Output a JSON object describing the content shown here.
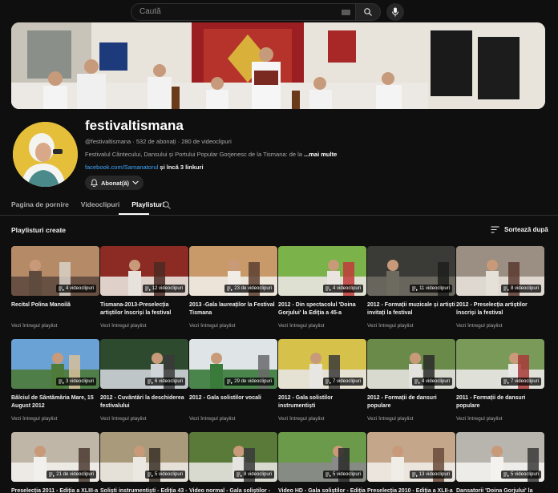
{
  "search": {
    "placeholder": "Caută"
  },
  "icons": {
    "keyboard": "keyboard-icon",
    "search": "search-icon",
    "mic": "mic-icon",
    "bell": "bell-icon",
    "chevron": "chevron-down-icon",
    "sort": "sort-icon",
    "playlist": "playlist-icon"
  },
  "channel": {
    "name": "festivaltismana",
    "handle": "@festivaltismana",
    "subscribers": "532 de abonați",
    "videos": "280 de videoclipuri",
    "separator": " · ",
    "description": "Festivalul Cântecului, Dansului și Portului Popular Gorjenesc de la Tismana: de la ediț",
    "more_label": "...mai multe",
    "link": "facebook.com/Samanatorul",
    "extra_links": " și încă 3 linkuri",
    "subscribe_label": "Abonat(ă)"
  },
  "tabs": [
    {
      "label": "Pagina de pornire"
    },
    {
      "label": "Videoclipuri"
    },
    {
      "label": "Playlisturi",
      "active": true
    }
  ],
  "section": {
    "title": "Playlisturi create",
    "sort_label": "Sortează după"
  },
  "view_full": "Vezi întregul playlist",
  "playlists": [
    {
      "title": "Recital Polina Manoilă",
      "count": "4 videoclipuri",
      "colors": [
        "#b58b67",
        "#5f4a3e",
        "#d7d1c8"
      ]
    },
    {
      "title": "Tismana-2013-Preselecția artiștilor înscriși la festival",
      "count": "12 videoclipuri",
      "colors": [
        "#8c2a24",
        "#e8e2dc",
        "#4a2a22"
      ]
    },
    {
      "title": "2013 -Gala laureaților la Festival Tismana",
      "count": "23 de videoclipuri",
      "colors": [
        "#c89a6a",
        "#f0ece6",
        "#5c4030"
      ]
    },
    {
      "title": "2012 - Din spectacolul 'Doina Gorjului' la Ediția a 45-a",
      "count": "4 videoclipuri",
      "colors": [
        "#7bb34a",
        "#e9e4e0",
        "#c23a3a"
      ]
    },
    {
      "title": "2012 - Formații muzicale și artiști invitați la festival",
      "count": "11 videoclipuri",
      "colors": [
        "#3a3a36",
        "#6d6a60",
        "#1e1e1c"
      ]
    },
    {
      "title": "2012 - Preselecția artiștilor înscriși la festival",
      "count": "8 videoclipuri",
      "colors": [
        "#9a8f82",
        "#e5e0d8",
        "#5a3a30"
      ]
    },
    {
      "title": "Bâlciul de Sântămăria Mare, 15 August 2012",
      "count": "3 videoclipuri",
      "colors": [
        "#6aa2d6",
        "#4e7a3a",
        "#d8c09a"
      ]
    },
    {
      "title": "2012 - Cuvântări la deschiderea festivalului",
      "count": "6 videoclipuri",
      "colors": [
        "#2e4a2e",
        "#cfd4d8",
        "#3a3a3a"
      ]
    },
    {
      "title": "2012 - Gala solistilor vocali",
      "count": "29 de videoclipuri",
      "colors": [
        "#dfe4e6",
        "#3a7a3a",
        "#6a6a6a"
      ]
    },
    {
      "title": "2012 - Gala solistilor instrumentiști",
      "count": "7 videoclipuri",
      "colors": [
        "#d6c24a",
        "#e8e6e2",
        "#3a3a3a"
      ]
    },
    {
      "title": "2012 - Formații de dansuri populare",
      "count": "4 videoclipuri",
      "colors": [
        "#6a8a4a",
        "#e4e2de",
        "#2a2a2a"
      ]
    },
    {
      "title": "2011 - Formații de dansuri populare",
      "count": "7 videoclipuri",
      "colors": [
        "#7a9a5a",
        "#eae8e4",
        "#a83a3a"
      ]
    },
    {
      "title": "Preselecția 2011 - Ediția a XLIII-a",
      "count": "21 de videoclipuri",
      "colors": [
        "#c0b6a8",
        "#f2f0ec",
        "#4a3a30"
      ]
    },
    {
      "title": "Soliști instrumentiști - Ediția 43 -",
      "count": "5 videoclipuri",
      "colors": [
        "#a89a7a",
        "#ebe8e2",
        "#3a3028"
      ]
    },
    {
      "title": "Video normal - Gala soliștilor -",
      "count": "8 videoclipuri",
      "colors": [
        "#5a7a3a",
        "#e6e4e0",
        "#3a3a3a"
      ]
    },
    {
      "title": "Video HD - Gala soliștilor - Ediția",
      "count": "5 videoclipuri",
      "colors": [
        "#6a9a4a",
        "#8a8a8a",
        "#2a2a2a"
      ]
    },
    {
      "title": "Preselecția 2010 - Ediția a XLII-a",
      "count": "13 videoclipuri",
      "colors": [
        "#c4a68a",
        "#f0ece6",
        "#6a4a3a"
      ]
    },
    {
      "title": "Dansatorii 'Doina Gorjului' la",
      "count": "5 videoclipuri",
      "colors": [
        "#b8b4ae",
        "#f4f2ee",
        "#3a3a3a"
      ]
    }
  ]
}
